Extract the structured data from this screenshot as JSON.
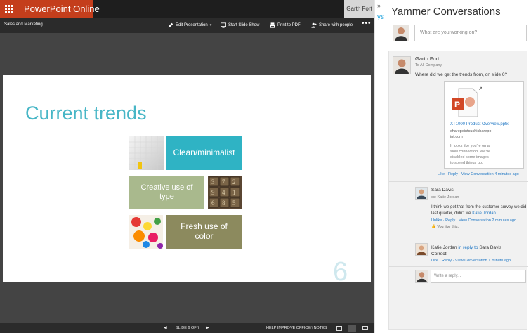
{
  "app": {
    "brand": "PowerPoint Online",
    "user": "Garth Fort"
  },
  "command_bar": {
    "doc_title": "Sales and Marketing",
    "edit": "Edit Presentation",
    "slideshow": "Start Slide Show",
    "print": "Print to PDF",
    "share": "Share with people"
  },
  "slide": {
    "title": "Current trends",
    "number": "6",
    "tiles": {
      "clean": "Clean/minimalist",
      "creative": "Creative use of type",
      "color": "Fresh use of color"
    }
  },
  "status_bar": {
    "slide_of": "SLIDE 6 OF 7",
    "help": "HELP IMPROVE OFFICE",
    "notes": "NOTES"
  },
  "yammer": {
    "title": "Yammer Conversations",
    "partial_text": "ys",
    "composer_placeholder": "What are you working on?",
    "post1": {
      "author": "Garth Fort",
      "audience": "To All Company",
      "message": "Where did we get the trends from, on slide 6?",
      "file_name": "XT1000 Product Overview.pptx",
      "file_host_1": "sharepointsushisharepo",
      "file_host_2": "int.com",
      "file_note_1": "It looks like you're on a",
      "file_note_2": "slow connection. We've",
      "file_note_3": "disabled some images",
      "file_note_4": "to speed things up.",
      "actions": "Like · Reply · View Conversation",
      "time": "4 minutes ago"
    },
    "post2": {
      "author": "Sara Davis",
      "cc": "cc: Katie Jordan",
      "message_1": "I think we got that from the customer survey we did",
      "message_2": "last quarter, didn't we",
      "mention": "Katie Jordan",
      "actions": "Unlike · Reply · View Conversation",
      "time": "2 minutes ago",
      "likes": "You like this."
    },
    "post3": {
      "author": "Katie Jordan",
      "in_reply_to": "in reply to",
      "reply_target": "Sara Davis",
      "message": "Correct!",
      "actions": "Like · Reply · View Conversation",
      "time": "1 minute ago"
    },
    "reply_placeholder": "Write a reply..."
  }
}
